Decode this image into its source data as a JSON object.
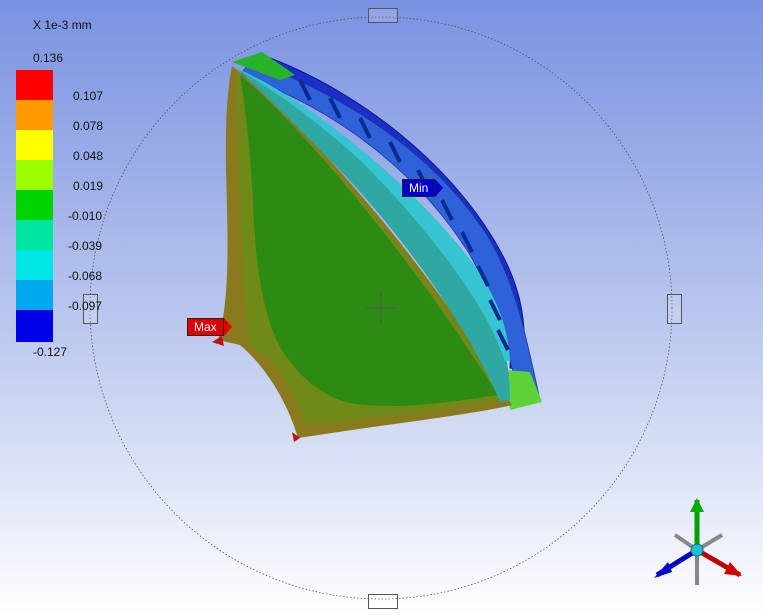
{
  "legend": {
    "units": "X 1e-3 mm",
    "max_value": "0.136",
    "ticks": [
      "0.107",
      "0.078",
      "0.048",
      "0.019",
      "-0.010",
      "-0.039",
      "-0.068",
      "-0.097"
    ],
    "min_value": "-0.127",
    "band_colors": [
      "#ff0000",
      "#ff9a00",
      "#ffff00",
      "#9cff00",
      "#00d400",
      "#00e6a0",
      "#00e6e6",
      "#00a8f0",
      "#0000e8"
    ]
  },
  "probes": {
    "max_label": "Max",
    "min_label": "Min",
    "max_color": "#e00000",
    "min_color": "#0000cc"
  },
  "triad": {
    "icon": "coordinate-triad-icon"
  }
}
